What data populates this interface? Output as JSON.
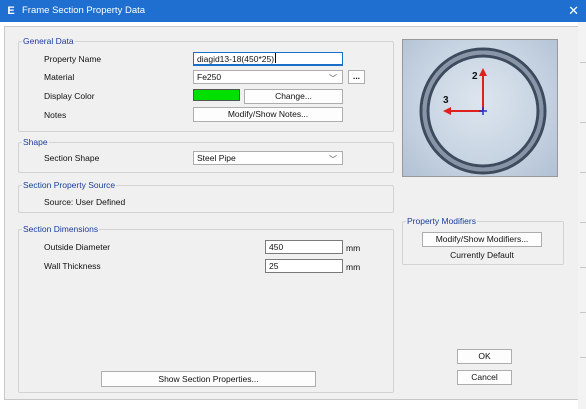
{
  "window": {
    "title": "Frame Section Property Data",
    "app_icon": "E"
  },
  "general_data": {
    "legend": "General Data",
    "property_name_label": "Property Name",
    "property_name_value": "diagid13-18(450*25)",
    "material_label": "Material",
    "material_value": "Fe250",
    "material_more_button": "...",
    "display_color_label": "Display Color",
    "display_color_value": "#00e000",
    "change_button": "Change...",
    "notes_label": "Notes",
    "notes_button": "Modify/Show Notes..."
  },
  "shape": {
    "legend": "Shape",
    "section_shape_label": "Section Shape",
    "section_shape_value": "Steel Pipe"
  },
  "source": {
    "legend": "Section Property Source",
    "text": "Source:  User Defined"
  },
  "dimensions": {
    "legend": "Section Dimensions",
    "outside_diameter_label": "Outside Diameter",
    "outside_diameter_value": "450",
    "outside_diameter_unit": "mm",
    "wall_thickness_label": "Wall Thickness",
    "wall_thickness_value": "25",
    "wall_thickness_unit": "mm"
  },
  "preview": {
    "axis_2_label": "2",
    "axis_3_label": "3"
  },
  "modifiers": {
    "legend": "Property Modifiers",
    "button": "Modify/Show Modifiers...",
    "status": "Currently Default"
  },
  "buttons": {
    "show_section_properties": "Show Section Properties...",
    "ok": "OK",
    "cancel": "Cancel"
  },
  "colors": {
    "titlebar": "#1f6fd1",
    "legend_text": "#1a3d9e",
    "display_color": "#00e000"
  }
}
